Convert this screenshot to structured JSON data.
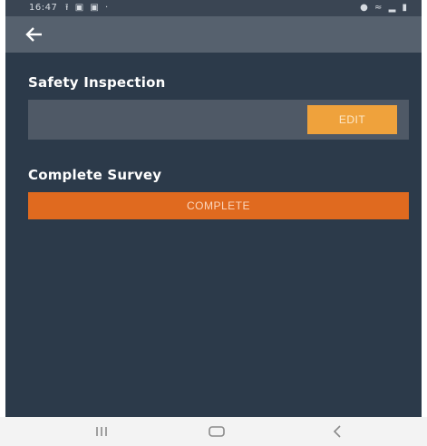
{
  "status_bar": {
    "time": "16:47",
    "left_icons": [
      "upload-icon",
      "image-icon",
      "image-icon",
      "dot-icon"
    ],
    "right_icons": [
      "alarm-icon",
      "wifi-icon",
      "signal-icon",
      "battery-icon"
    ]
  },
  "app_bar": {
    "back_icon": "arrow-left-icon"
  },
  "sections": {
    "safety": {
      "title": "Safety Inspection",
      "edit_label": "EDIT"
    },
    "survey": {
      "title": "Complete Survey",
      "complete_label": "COMPLETE"
    }
  },
  "nav_bar": {
    "icons": [
      "recents-icon",
      "home-icon",
      "back-icon"
    ]
  },
  "colors": {
    "background": "#2c3a4a",
    "app_bar": "#56616e",
    "card": "#4f5966",
    "edit_button": "#efa23c",
    "complete_button": "#e06a1f",
    "nav_bar": "#f3f3f3"
  }
}
